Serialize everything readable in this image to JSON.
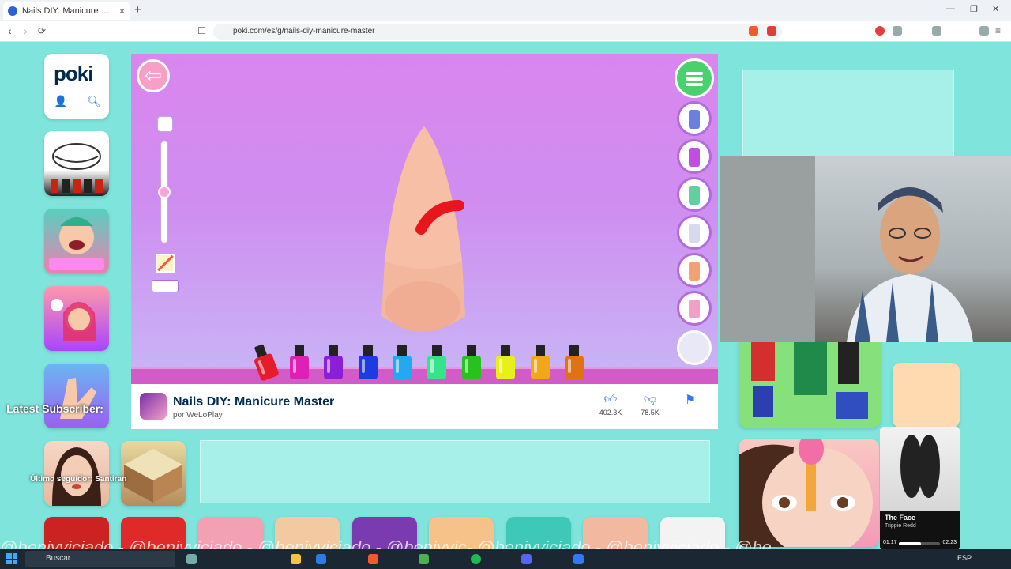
{
  "browser": {
    "tab_title": "Nails DIY: Manicure Master",
    "new_tab": "+",
    "tab_close": "×",
    "url": "poki.com/es/g/nails-diy-manicure-master"
  },
  "poki": {
    "logo": "poki"
  },
  "game": {
    "title": "Nails DIY: Manicure Master",
    "author": "por WeLoPlay",
    "likes": "402.3K",
    "dislikes": "78.5K",
    "polish_colors": [
      "#e81b2a",
      "#e01fb4",
      "#8a1fd6",
      "#1d3be0",
      "#22a9f0",
      "#34e38a",
      "#27c21e",
      "#e8f01a",
      "#f0a81a",
      "#e07216"
    ],
    "tool_colors": [
      "#6b7fe0",
      "#c24ee0",
      "#5fd0a0",
      "#d8d8f0",
      "#f3a074",
      "#f2a0c8"
    ]
  },
  "overlays": {
    "latest_subscriber": "Latest Subscriber:",
    "last_follower": "Último seguidor: Santiran",
    "watermark": "@benjyviciado - @benjyviciado - @benjyviciado - @benjyvic- @benjyviciado - @benjyviciado - @be"
  },
  "music": {
    "title": "The Face",
    "artist": "Trippie Redd",
    "elapsed": "01:17",
    "total": "02:23",
    "progress": 0.54
  },
  "taskbar": {
    "search": "Buscar",
    "lang": "ESP"
  }
}
